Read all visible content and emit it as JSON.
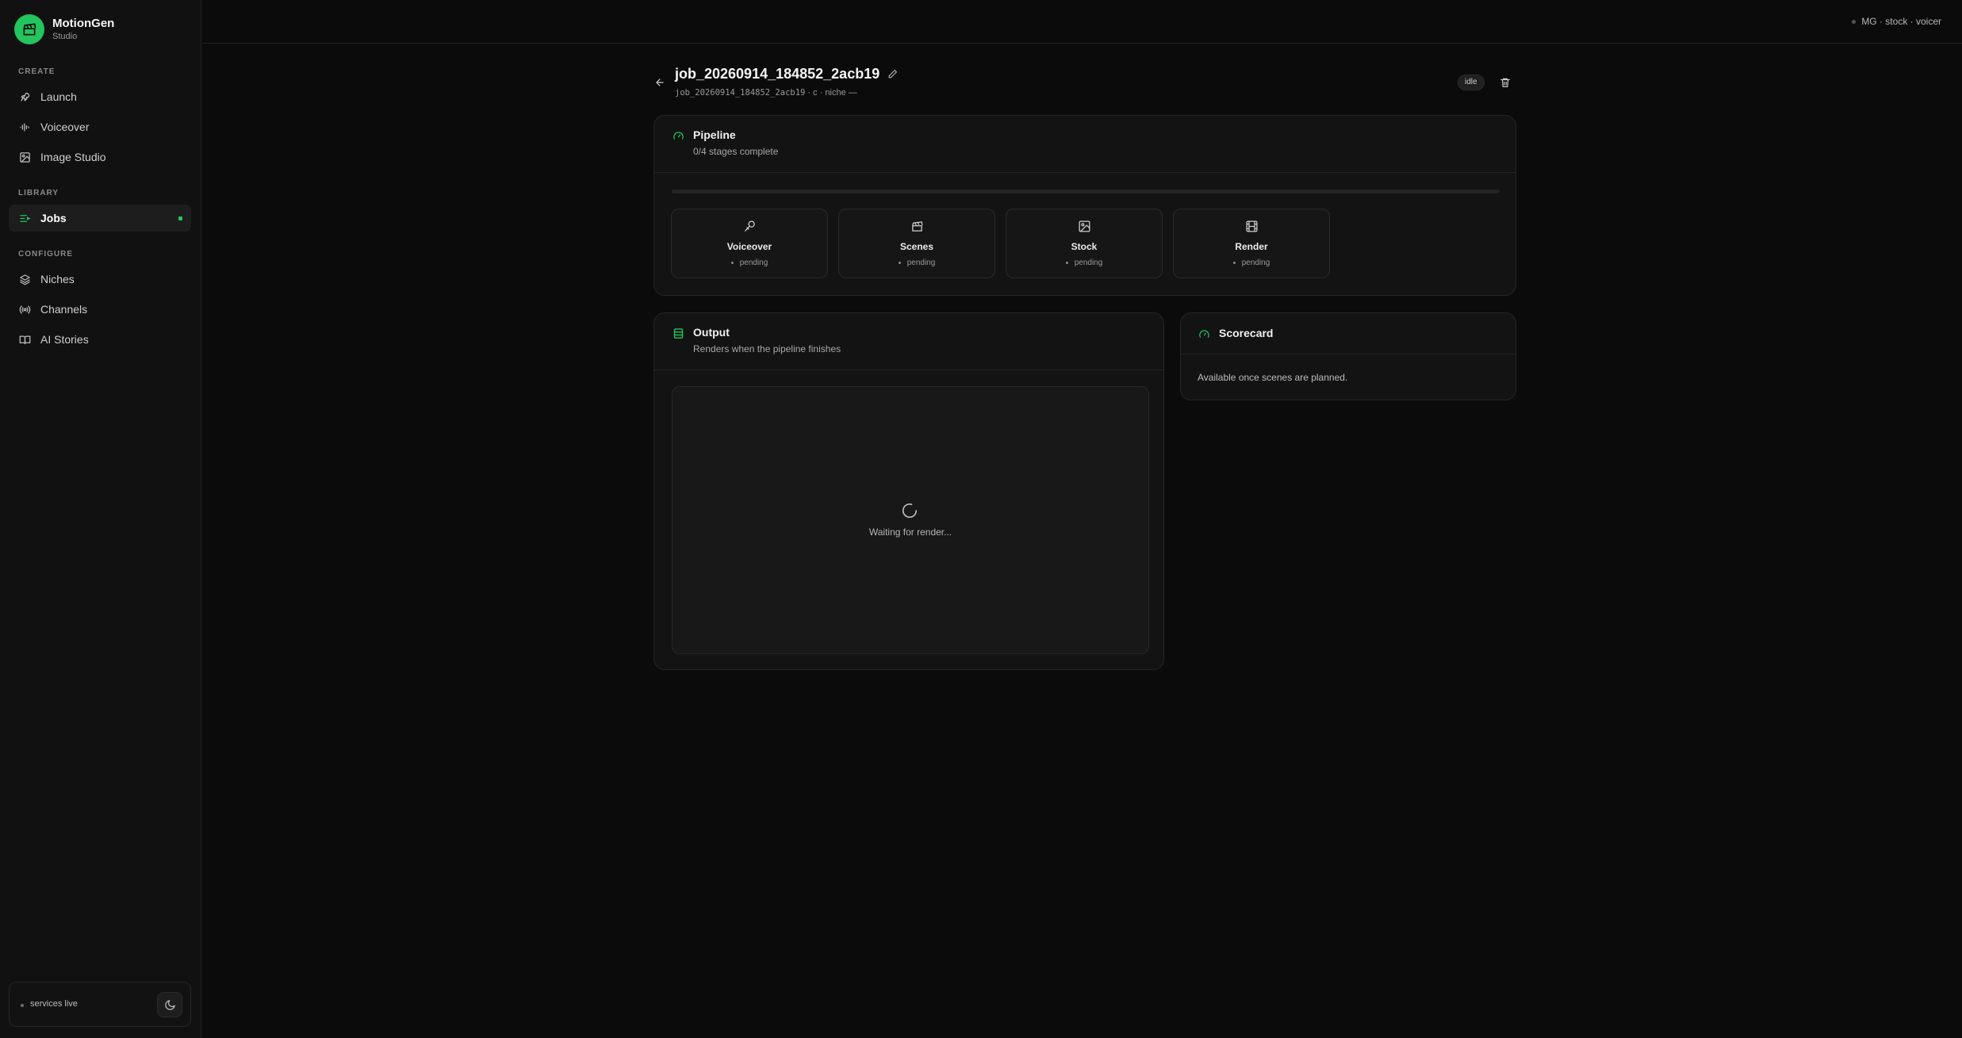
{
  "brand": {
    "name": "MotionGen",
    "subtitle": "Studio"
  },
  "sidebar": {
    "sections": [
      {
        "label": "CREATE",
        "items": [
          {
            "label": "Launch",
            "icon": "rocket-icon"
          },
          {
            "label": "Voiceover",
            "icon": "audio-wave-icon"
          },
          {
            "label": "Image Studio",
            "icon": "image-icon"
          }
        ]
      },
      {
        "label": "LIBRARY",
        "items": [
          {
            "label": "Jobs",
            "icon": "list-icon",
            "active": true
          }
        ]
      },
      {
        "label": "CONFIGURE",
        "items": [
          {
            "label": "Niches",
            "icon": "layers-icon"
          },
          {
            "label": "Channels",
            "icon": "broadcast-icon"
          },
          {
            "label": "AI Stories",
            "icon": "book-icon"
          }
        ]
      }
    ],
    "status": "services live"
  },
  "topbar": {
    "status": "MG · stock · voicer"
  },
  "job": {
    "title": "job_20260914_184852_2acb19",
    "meta_id": "job_20260914_184852_2acb19",
    "meta_rest": " · c · niche —",
    "state": "idle"
  },
  "pipeline": {
    "title": "Pipeline",
    "subtitle": "0/4 stages complete",
    "progress": 0,
    "stages": [
      {
        "name": "Voiceover",
        "status": "pending",
        "icon": "microphone-icon"
      },
      {
        "name": "Scenes",
        "status": "pending",
        "icon": "clapperboard-icon"
      },
      {
        "name": "Stock",
        "status": "pending",
        "icon": "gallery-icon"
      },
      {
        "name": "Render",
        "status": "pending",
        "icon": "film-icon"
      }
    ]
  },
  "output": {
    "title": "Output",
    "subtitle": "Renders when the pipeline finishes",
    "waiting": "Waiting for render..."
  },
  "scorecard": {
    "title": "Scorecard",
    "message": "Available once scenes are planned."
  },
  "colors": {
    "accent": "#22c55e",
    "background": "#0b0b0b",
    "card": "#131313"
  }
}
